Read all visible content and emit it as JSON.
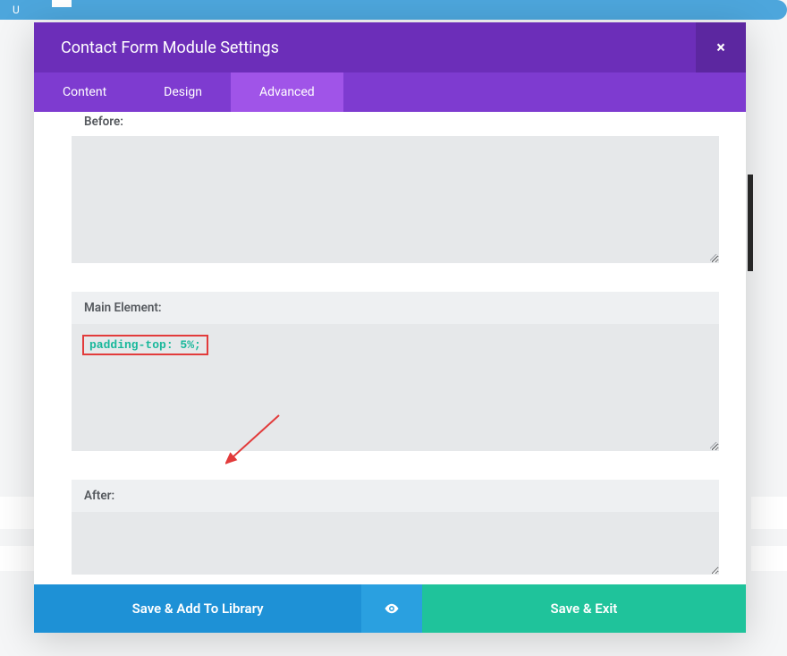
{
  "modal": {
    "title": "Contact Form Module Settings",
    "close": "×"
  },
  "tabs": [
    {
      "label": "Content",
      "active": false
    },
    {
      "label": "Design",
      "active": false
    },
    {
      "label": "Advanced",
      "active": true
    }
  ],
  "fields": {
    "before": {
      "label": "Before:",
      "value": ""
    },
    "main": {
      "label": "Main Element:",
      "value": "padding-top: 5%;"
    },
    "after": {
      "label": "After:",
      "value": ""
    }
  },
  "footer": {
    "save_library": "Save & Add To Library",
    "save_exit": "Save & Exit"
  },
  "bg": {
    "left_badge": "U"
  },
  "colors": {
    "header": "#6c2eb9",
    "tab_bar": "#7e3bd0",
    "tab_active": "#a054e8",
    "save_lib": "#1e91d6",
    "eye": "#2aa0e0",
    "save_exit": "#1fc39b",
    "annotation": "#e23b3b",
    "code": "#18b89b"
  }
}
